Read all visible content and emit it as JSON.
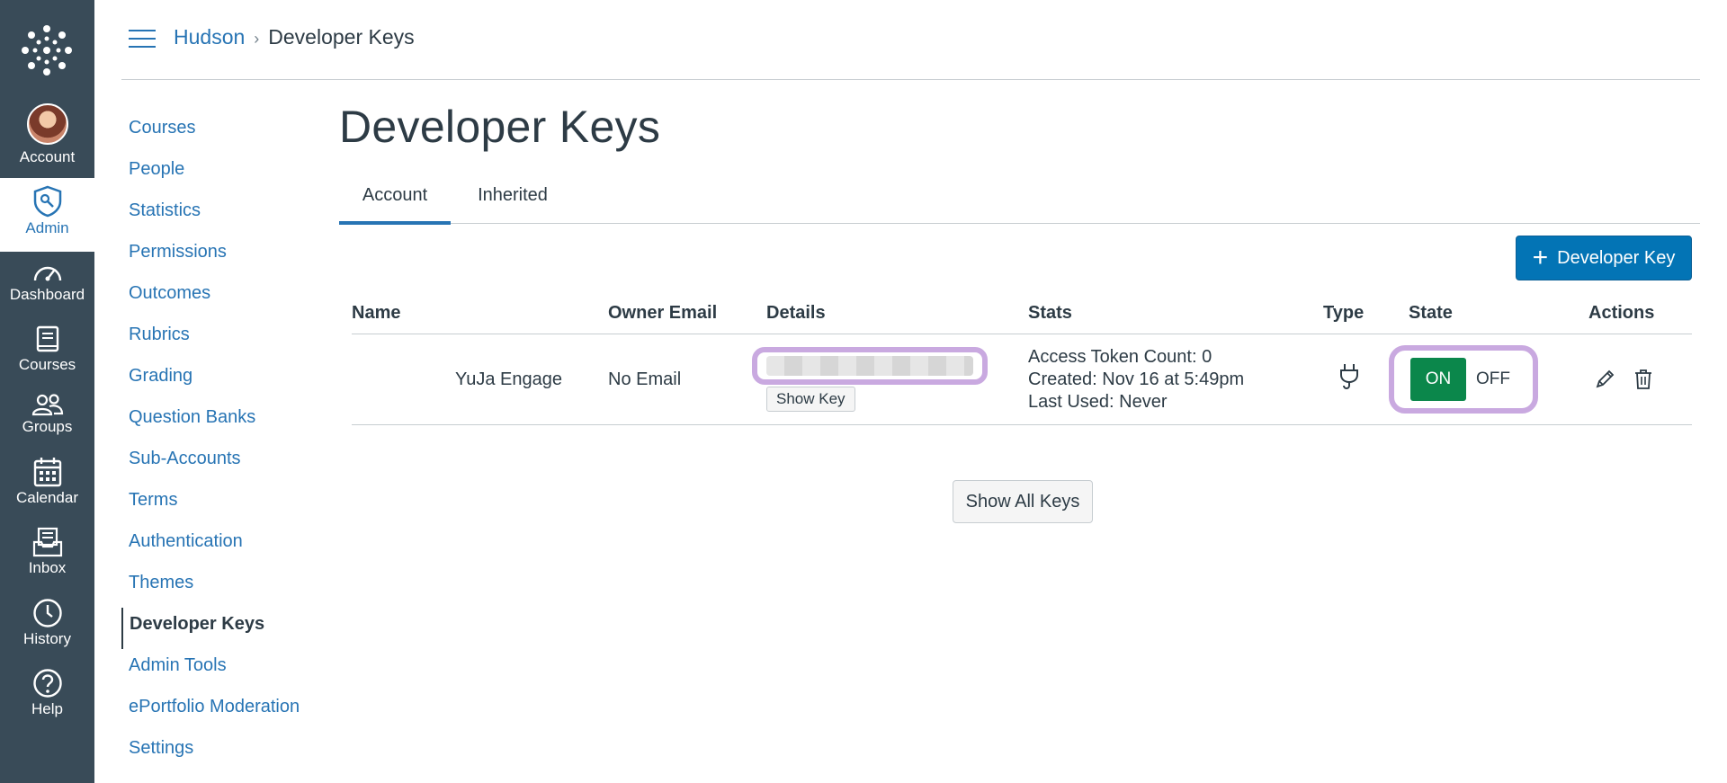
{
  "global_nav": {
    "items": [
      {
        "label": "Account",
        "icon": "avatar"
      },
      {
        "label": "Admin",
        "icon": "shield-icon"
      },
      {
        "label": "Dashboard",
        "icon": "dashboard-icon"
      },
      {
        "label": "Courses",
        "icon": "book-icon"
      },
      {
        "label": "Groups",
        "icon": "groups-icon"
      },
      {
        "label": "Calendar",
        "icon": "calendar-icon"
      },
      {
        "label": "Inbox",
        "icon": "inbox-icon"
      },
      {
        "label": "History",
        "icon": "clock-icon"
      },
      {
        "label": "Help",
        "icon": "help-icon"
      }
    ]
  },
  "breadcrumb": {
    "root": "Hudson",
    "current": "Developer Keys"
  },
  "subnav": {
    "items": [
      "Courses",
      "People",
      "Statistics",
      "Permissions",
      "Outcomes",
      "Rubrics",
      "Grading",
      "Question Banks",
      "Sub-Accounts",
      "Terms",
      "Authentication",
      "Themes",
      "Developer Keys",
      "Admin Tools",
      "ePortfolio Moderation",
      "Settings"
    ],
    "active": "Developer Keys"
  },
  "page": {
    "title": "Developer Keys",
    "tabs": [
      "Account",
      "Inherited"
    ],
    "active_tab": "Account",
    "add_button": "Developer Key",
    "show_all": "Show All Keys"
  },
  "table": {
    "headers": [
      "Name",
      "Owner Email",
      "Details",
      "Stats",
      "Type",
      "State",
      "Actions"
    ],
    "rows": [
      {
        "name": "YuJa Engage",
        "owner_email": "No Email",
        "show_key": "Show Key",
        "stats": [
          "Access Token Count: 0",
          "Created: Nov 16 at 5:49pm",
          "Last Used: Never"
        ],
        "type_icon": "plug-icon",
        "state_on": "ON",
        "state_off": "OFF"
      }
    ]
  },
  "colors": {
    "nav_bg": "#394b58",
    "accent": "#2774b4",
    "on_green": "#0b874b",
    "highlight": "#c9a9e0"
  }
}
